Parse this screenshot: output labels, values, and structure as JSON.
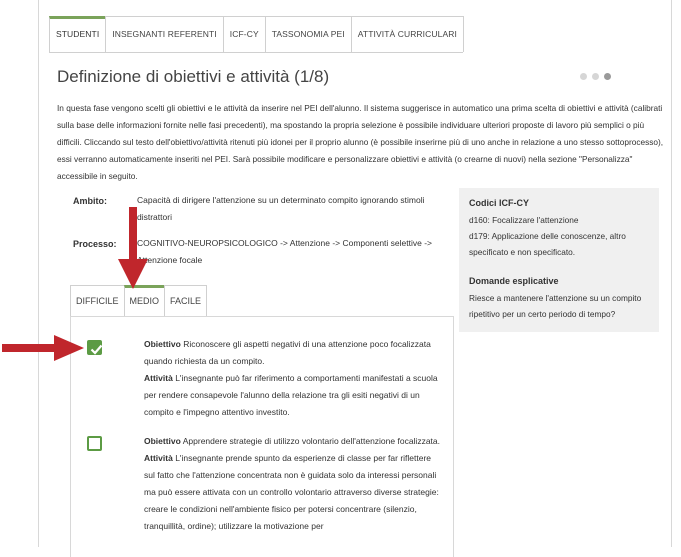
{
  "tabs": [
    {
      "label": "STUDENTI",
      "active": true
    },
    {
      "label": "INSEGNANTI REFERENTI",
      "active": false
    },
    {
      "label": "ICF-CY",
      "active": false
    },
    {
      "label": "TASSONOMIA PEI",
      "active": false
    },
    {
      "label": "ATTIVITÀ CURRICULARI",
      "active": false
    }
  ],
  "title": "Definizione di obiettivi e attività (1/8)",
  "pager": {
    "total": 3,
    "current": 3
  },
  "intro": "In questa fase vengono scelti gli obiettivi e le attività da inserire nel PEI dell'alunno. Il sistema suggerisce in automatico una prima scelta di obiettivi e attività (calibrati sulla base delle informazioni fornite nelle fasi precedenti), ma spostando la propria selezione è possibile individuare ulteriori proposte di lavoro più semplici o più difficili. Cliccando sul testo dell'obiettivo/attività ritenuti più idonei per il proprio alunno (è possibile inserirne più di uno anche in relazione a uno stesso sottoprocesso), essi verranno automaticamente inseriti nel PEI. Sarà possibile modificare e personalizzare obiettivi e attività (o crearne di nuovi) nella sezione \"Personalizza\" accessibile in seguito.",
  "ambito": {
    "label": "Ambito:",
    "value": "Capacità di dirigere l'attenzione su un determinato compito ignorando stimoli distrattori"
  },
  "processo": {
    "label": "Processo:",
    "value": "COGNITIVO-NEUROPSICOLOGICO -> Attenzione -> Componenti selettive -> Attenzione focale"
  },
  "codes": {
    "heading": "Codici ICF-CY",
    "items": [
      "d160: Focalizzare l'attenzione",
      "d179: Applicazione delle conoscenze, altro specificato e non specificato."
    ],
    "questions_heading": "Domande esplicative",
    "questions_text": "Riesce a mantenere l'attenzione su un compito ripetitivo per un certo periodo di tempo?"
  },
  "difficulty_tabs": [
    {
      "label": "DIFFICILE",
      "active": false
    },
    {
      "label": "MEDIO",
      "active": true
    },
    {
      "label": "FACILE",
      "active": false
    }
  ],
  "objectives": [
    {
      "checked": true,
      "obiettivo_label": "Obiettivo",
      "obiettivo": "Riconoscere gli aspetti negativi di una attenzione poco focalizzata quando richiesta da un compito.",
      "attivita_label": "Attività",
      "attivita": "L'insegnante può far riferimento a comportamenti manifestati a scuola per rendere consapevole l'alunno della relazione tra gli esiti negativi di un compito e l'impegno attentivo investito."
    },
    {
      "checked": false,
      "obiettivo_label": "Obiettivo",
      "obiettivo": "Apprendere strategie di utilizzo volontario dell'attenzione focalizzata.",
      "attivita_label": "Attività",
      "attivita": "L'insegnante prende spunto da esperienze di classe per far riflettere sul fatto che l'attenzione concentrata non è guidata solo da interessi personali ma può essere attivata con un controllo volontario attraverso diverse strategie: creare le condizioni nell'ambiente fisico per potersi concentrare (silenzio, tranquillità, ordine); utilizzare la motivazione per"
    }
  ],
  "colors": {
    "accent": "#7aa35a",
    "checkbox": "#5c9b44",
    "arrow": "#c0262c"
  }
}
